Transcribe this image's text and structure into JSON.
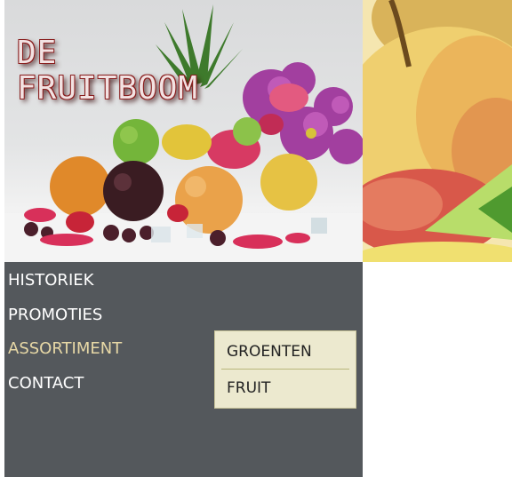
{
  "brand": {
    "logo_line1": "DE",
    "logo_line2": "FRUITBOOM"
  },
  "nav": {
    "items": [
      {
        "label": "HISTORIEK"
      },
      {
        "label": "PROMOTIES"
      },
      {
        "label": "ASSORTIMENT"
      },
      {
        "label": "CONTACT"
      }
    ],
    "active": "ASSORTIMENT"
  },
  "submenu": {
    "items": [
      {
        "label": "GROENTEN"
      },
      {
        "label": "FRUIT"
      }
    ]
  },
  "colors": {
    "nav_bg": "#54585c",
    "nav_text": "#ffffff",
    "nav_active_text": "#e7d8a6",
    "submenu_bg": "#ece9cf",
    "logo_outline": "#8a1f1f"
  }
}
